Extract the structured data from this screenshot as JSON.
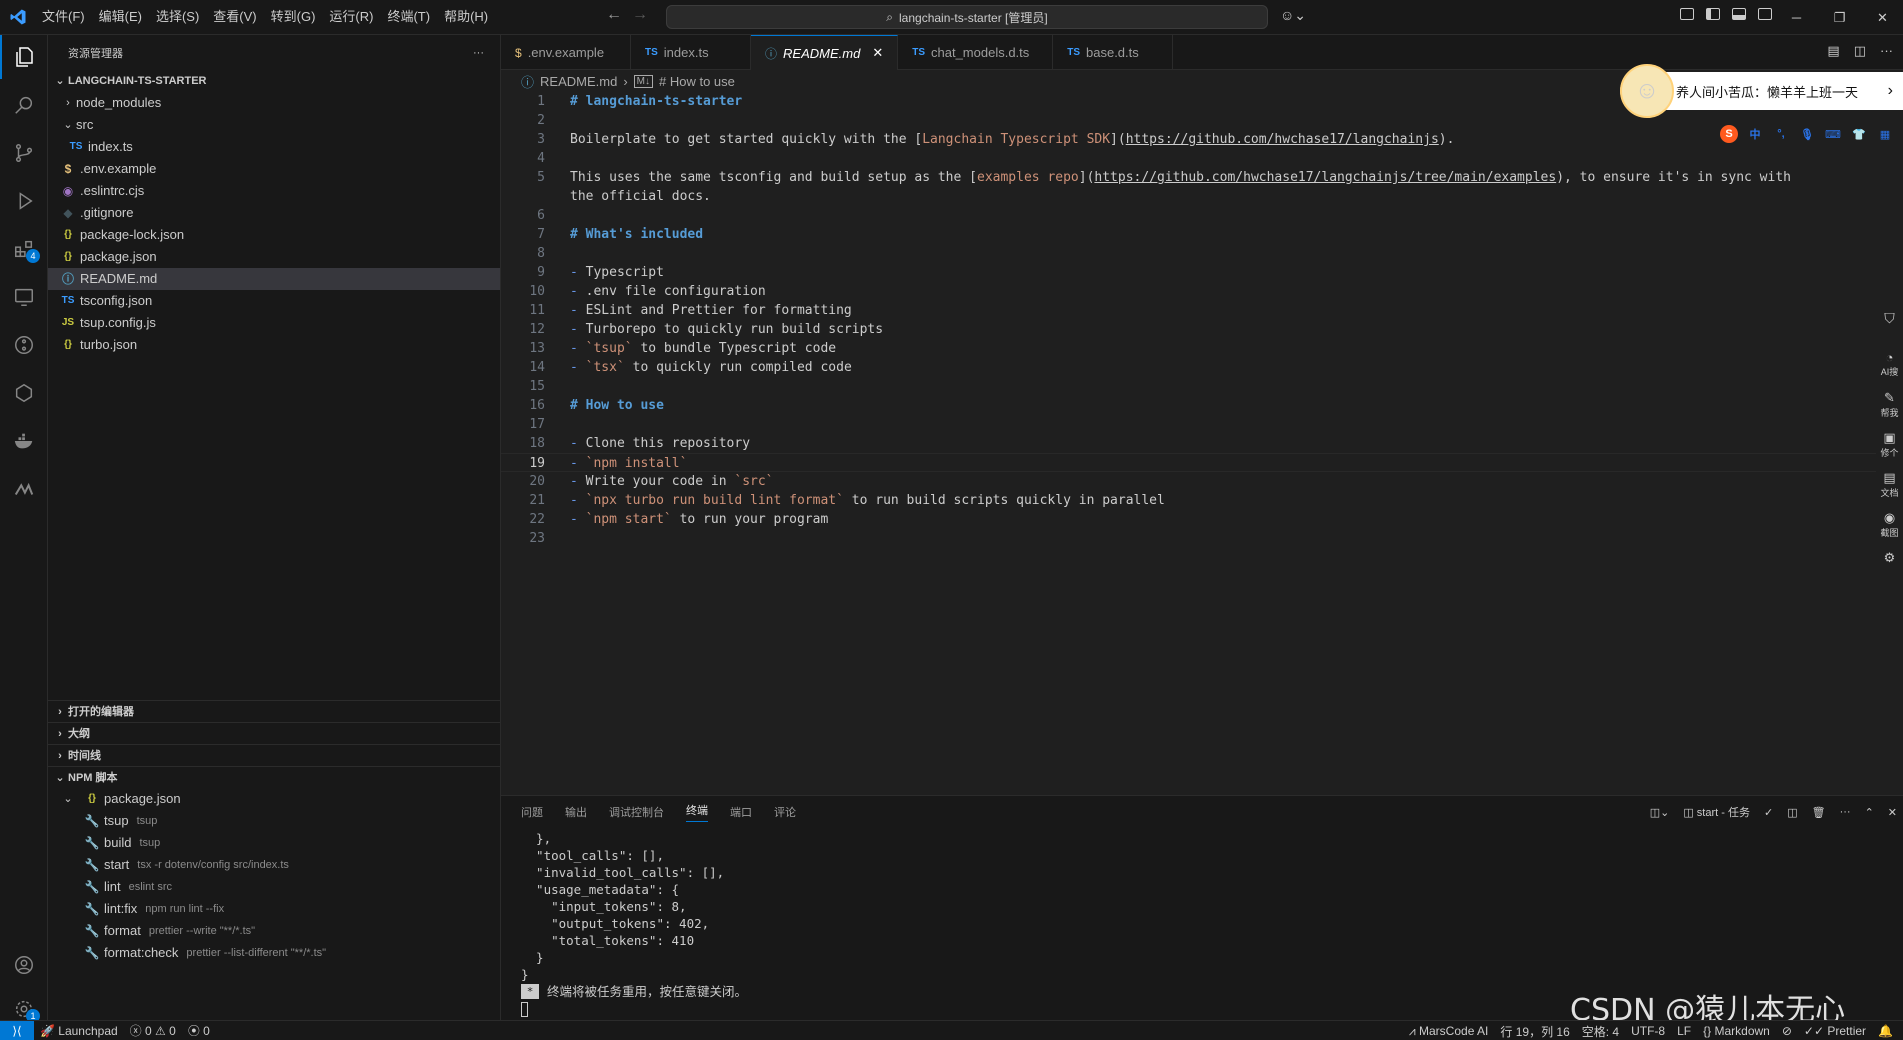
{
  "menu": [
    "文件(F)",
    "编辑(E)",
    "选择(S)",
    "查看(V)",
    "转到(G)",
    "运行(R)",
    "终端(T)",
    "帮助(H)"
  ],
  "search": {
    "text": "langchain-ts-starter [管理员]"
  },
  "activity": {
    "extensions_badge": "4",
    "accounts_badge": "1"
  },
  "sidebar": {
    "title": "资源管理器",
    "project": "LANGCHAIN-TS-STARTER",
    "tree": [
      {
        "label": "node_modules",
        "icon": "",
        "chev": "›"
      },
      {
        "label": "src",
        "icon": "",
        "chev": "⌄"
      },
      {
        "label": "index.ts",
        "icon": "TS"
      },
      {
        "label": ".env.example",
        "icon": "$"
      },
      {
        "label": ".eslintrc.cjs",
        "icon": "◉"
      },
      {
        "label": ".gitignore",
        "icon": "◆"
      },
      {
        "label": "package-lock.json",
        "icon": "{}"
      },
      {
        "label": "package.json",
        "icon": "{}"
      },
      {
        "label": "README.md",
        "icon": "ⓘ"
      },
      {
        "label": "tsconfig.json",
        "icon": "TS"
      },
      {
        "label": "tsup.config.js",
        "icon": "JS"
      },
      {
        "label": "turbo.json",
        "icon": "{}"
      }
    ],
    "sections": {
      "open_editors": "打开的编辑器",
      "outline": "大纲",
      "timeline": "时间线",
      "npm": "NPM 脚本"
    },
    "npm_file": "package.json",
    "npm_scripts": [
      {
        "name": "tsup",
        "cmd": "tsup"
      },
      {
        "name": "build",
        "cmd": "tsup"
      },
      {
        "name": "start",
        "cmd": "tsx -r dotenv/config src/index.ts"
      },
      {
        "name": "lint",
        "cmd": "eslint src"
      },
      {
        "name": "lint:fix",
        "cmd": "npm run lint --fix"
      },
      {
        "name": "format",
        "cmd": "prettier --write \"**/*.ts\""
      },
      {
        "name": "format:check",
        "cmd": "prettier --list-different \"**/*.ts\""
      }
    ]
  },
  "tabs": [
    {
      "label": ".env.example",
      "icon": "$"
    },
    {
      "label": "index.ts",
      "icon": "TS"
    },
    {
      "label": "README.md",
      "icon": "ⓘ",
      "close": "✕"
    },
    {
      "label": "chat_models.d.ts",
      "icon": "TS"
    },
    {
      "label": "base.d.ts",
      "icon": "TS"
    }
  ],
  "breadcrumb": {
    "file": "README.md",
    "section": "# How to use"
  },
  "editor": {
    "lines": [
      "# langchain-ts-starter",
      "",
      "Boilerplate to get started quickly with the [Langchain Typescript SDK](https://github.com/hwchase17/langchainjs).",
      "",
      "This uses the same tsconfig and build setup as the [examples repo](https://github.com/hwchase17/langchainjs/tree/main/examples), to ensure it's in sync with",
      "the official docs.",
      "",
      "# What's included",
      "",
      "- Typescript",
      "- .env file configuration",
      "- ESLint and Prettier for formatting",
      "- Turborepo to quickly run build scripts",
      "- `tsup` to bundle Typescript code",
      "- `tsx` to quickly run compiled code",
      "",
      "# How to use",
      "",
      "- Clone this repository",
      "- `npm install`",
      "- Write your code in `src`",
      "- `npx turbo run build lint format` to run build scripts quickly in parallel",
      "- `npm start` to run your program",
      ""
    ],
    "line_numbers": [
      "1",
      "2",
      "3",
      "4",
      "5",
      "",
      "6",
      "7",
      "8",
      "9",
      "10",
      "11",
      "12",
      "13",
      "14",
      "15",
      "16",
      "17",
      "18",
      "19",
      "20",
      "21",
      "22",
      "23"
    ]
  },
  "overlay": {
    "ime_text": "养人间小苦瓜：懒羊羊上班一天",
    "ime_arrow": "›",
    "ime_logo": "S",
    "ime_lang": "中",
    "strip": [
      "AI搜",
      "帮我",
      "修个",
      "文档",
      "截图"
    ]
  },
  "panel": {
    "tabs": [
      "问题",
      "输出",
      "调试控制台",
      "终端",
      "端口",
      "评论"
    ],
    "task": "start - 任务",
    "terminal": [
      "  },",
      "  \"tool_calls\": [],",
      "  \"invalid_tool_calls\": [],",
      "  \"usage_metadata\": {",
      "    \"input_tokens\": 8,",
      "    \"output_tokens\": 402,",
      "    \"total_tokens\": 410",
      "  }",
      "}"
    ],
    "reuse_msg": "终端将被任务重用，按任意键关闭。",
    "star": "*"
  },
  "watermark": "CSDN @猿儿本无心",
  "status": {
    "launchpad": "Launchpad",
    "errors": "0",
    "warnings": "0",
    "ports": "0",
    "marscode": "MarsCode AI",
    "position": "行 19，列 16",
    "spaces": "空格: 4",
    "encoding": "UTF-8",
    "eol": "LF",
    "language": "Markdown",
    "prettier": "Prettier"
  }
}
